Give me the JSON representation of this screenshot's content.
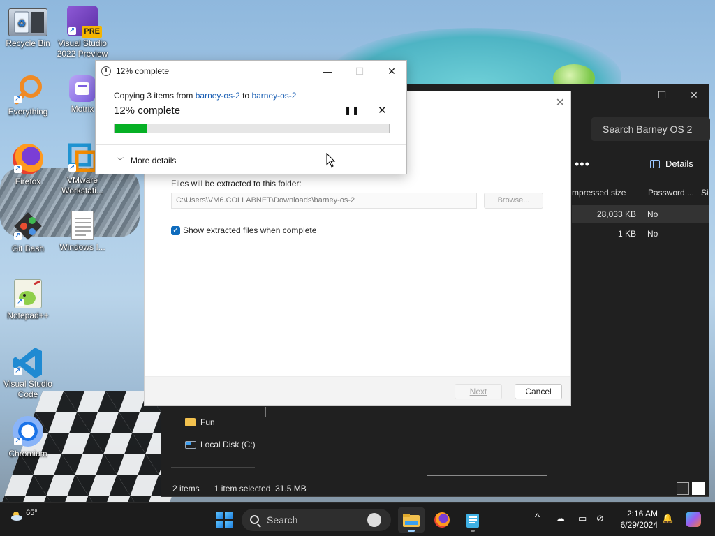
{
  "desktop": {
    "icons": [
      {
        "label": "Recycle Bin",
        "icon": "recycle-bin-icon"
      },
      {
        "label": "Visual Studio 2022 Preview",
        "icon": "visual-studio-preview-icon",
        "badge": "PRE"
      },
      {
        "label": "Everything",
        "icon": "everything-search-icon"
      },
      {
        "label": "Motrix",
        "icon": "motrix-icon"
      },
      {
        "label": "Firefox",
        "icon": "firefox-icon"
      },
      {
        "label": "VMware Workstati...",
        "icon": "vmware-icon"
      },
      {
        "label": "Git Bash",
        "icon": "git-bash-icon"
      },
      {
        "label": "Windows I...",
        "icon": "document-icon"
      },
      {
        "label": "Notepad++",
        "icon": "notepadpp-icon"
      },
      {
        "label": "Visual Studio Code",
        "icon": "vscode-icon"
      },
      {
        "label": "Chromium",
        "icon": "chromium-icon"
      }
    ]
  },
  "copy_dialog": {
    "title": "12% complete",
    "line_prefix": "Copying 3 items from ",
    "source": "barney-os-2",
    "line_mid": " to ",
    "dest": "barney-os-2",
    "percent_text": "12% complete",
    "progress": 0.12,
    "more_details": "More details",
    "minimize": "—",
    "maximize": "☐",
    "close": "✕",
    "pause_glyph": "❚❚",
    "cancel_glyph": "✕"
  },
  "wizard": {
    "close": "✕",
    "folder_label": "Files will be extracted to this folder:",
    "folder_path": "C:\\Users\\VM6.COLLABNET\\Downloads\\barney-os-2",
    "browse": "Browse...",
    "show_files_label": "Show extracted files when complete",
    "show_files_checked": true,
    "next": "Next",
    "cancel": "Cancel"
  },
  "explorer": {
    "search_placeholder": "Search Barney OS 2",
    "more": "•••",
    "details": "Details",
    "columns": [
      "mpressed size",
      "Password ...",
      "Si"
    ],
    "rows": [
      {
        "size": "28,033 KB",
        "password": "No"
      },
      {
        "size": "1 KB",
        "password": "No"
      }
    ],
    "nav": [
      {
        "label": "Fun",
        "icon": "folder-icon"
      },
      {
        "label": "Local Disk (C:)",
        "icon": "drive-icon"
      }
    ],
    "status": {
      "items": "2 items",
      "selected": "1 item selected  31.5 MB"
    },
    "window_controls": {
      "minimize": "—",
      "maximize": "☐",
      "close": "✕"
    }
  },
  "taskbar": {
    "weather": "65°",
    "search_label": "Search",
    "time": "2:16 AM",
    "date": "6/29/2024",
    "tray_chevron": "^"
  }
}
